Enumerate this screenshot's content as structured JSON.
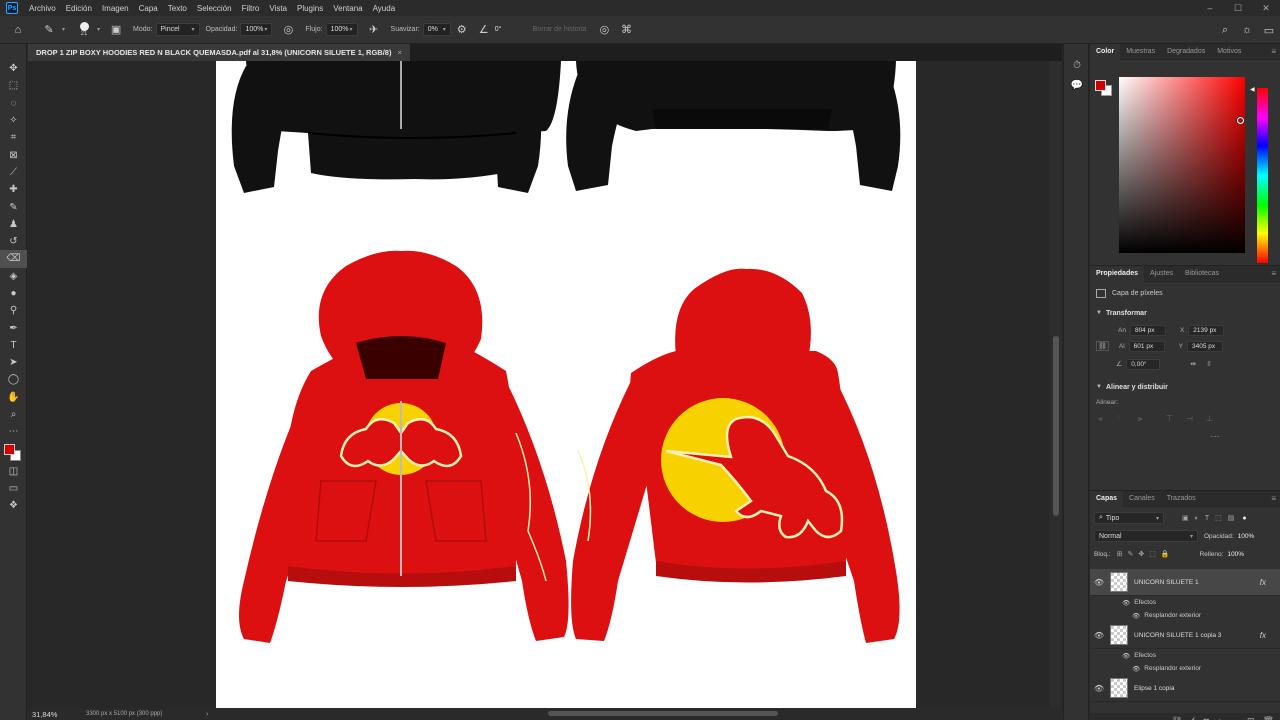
{
  "menu": {
    "app_logo": "Ps",
    "items": [
      "Archivo",
      "Edición",
      "Imagen",
      "Capa",
      "Texto",
      "Selección",
      "Filtro",
      "Vista",
      "Plugins",
      "Ventana",
      "Ayuda"
    ]
  },
  "options": {
    "brush_size": "21",
    "mode_label": "Modo:",
    "mode_value": "Pincel",
    "opacity_label": "Opacidad:",
    "opacity_value": "100%",
    "flow_label": "Flujo:",
    "flow_value": "100%",
    "smooth_label": "Suavizar:",
    "smooth_value": "0%",
    "angle_value": "0°",
    "erase_history": "Borrar de historia"
  },
  "document": {
    "tab_title": "DROP 1 ZIP BOXY HOODIES RED N BLACK QUEMASDA.pdf al 31,8% (UNICORN SILUETE 1, RGB/8)",
    "zoom": "31,84%",
    "size_info": "3300 px x 5100 px (300 ppp)"
  },
  "artwork": {
    "hoodie_black": "#111111",
    "hoodie_red": "#dc1010",
    "moon_yellow": "#f7d100",
    "silhouette_outline": "#fdf1b0"
  },
  "color_panel": {
    "tabs": [
      "Color",
      "Muestras",
      "Degradados",
      "Motivos"
    ],
    "foreground": "#d10000",
    "background": "#ffffff"
  },
  "properties": {
    "tabs": [
      "Propiedades",
      "Ajustes",
      "Bibliotecas"
    ],
    "layer_kind": "Capa de píxeles",
    "transform_title": "Transformar",
    "an_label": "An",
    "an_value": "804 px",
    "al_label": "Al",
    "al_value": "601 px",
    "x_label": "X",
    "x_value": "2139 px",
    "y_label": "Y",
    "y_value": "3405 px",
    "angle_value": "0,00°",
    "align_title": "Alinear y distribuir",
    "align_label": "Alinear:"
  },
  "layers": {
    "tabs": [
      "Capas",
      "Canales",
      "Trazados"
    ],
    "filter_kind": "Tipo",
    "blend_mode": "Normal",
    "opacity_label": "Opacidad:",
    "opacity_value": "100%",
    "lock_label": "Bloq.:",
    "fill_label": "Relleno:",
    "fill_value": "100%",
    "items": [
      {
        "name": "UNICORN SILUETE 1",
        "effects_label": "Efectos",
        "effect": "Resplandor exterior"
      },
      {
        "name": "UNICORN SILUETE 1 copia 3",
        "effects_label": "Efectos",
        "effect": "Resplandor exterior"
      },
      {
        "name": "Elipse 1 copia"
      }
    ],
    "fx_label": "fx"
  }
}
